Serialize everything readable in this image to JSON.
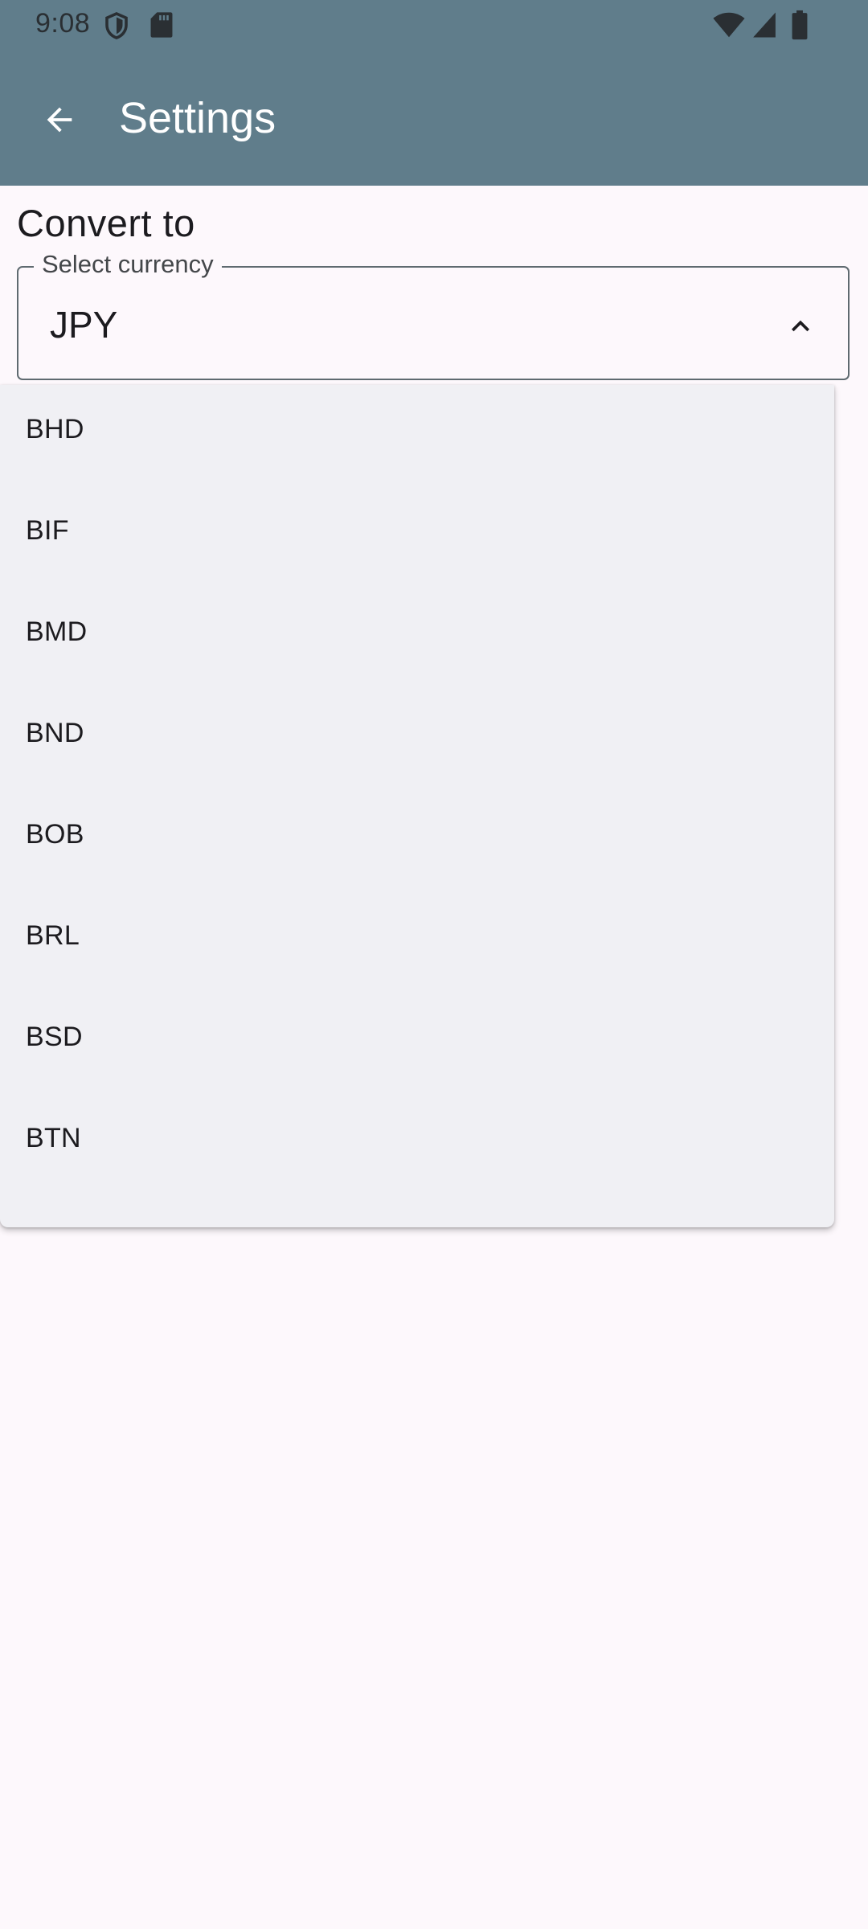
{
  "status_bar": {
    "time": "9:08",
    "icons": [
      "shield-icon",
      "sd-card-icon",
      "wifi-icon",
      "cell-signal-icon",
      "battery-icon"
    ]
  },
  "app_bar": {
    "title": "Settings",
    "back_icon": "arrow-back-icon",
    "color": "#607d8b"
  },
  "section": {
    "label": "Convert to"
  },
  "currency_select": {
    "legend": "Select currency",
    "value": "JPY",
    "expanded": true,
    "chevron_icon": "chevron-up-icon"
  },
  "dropdown": {
    "options": [
      "BHD",
      "BIF",
      "BMD",
      "BND",
      "BOB",
      "BRL",
      "BSD",
      "BTN"
    ]
  }
}
